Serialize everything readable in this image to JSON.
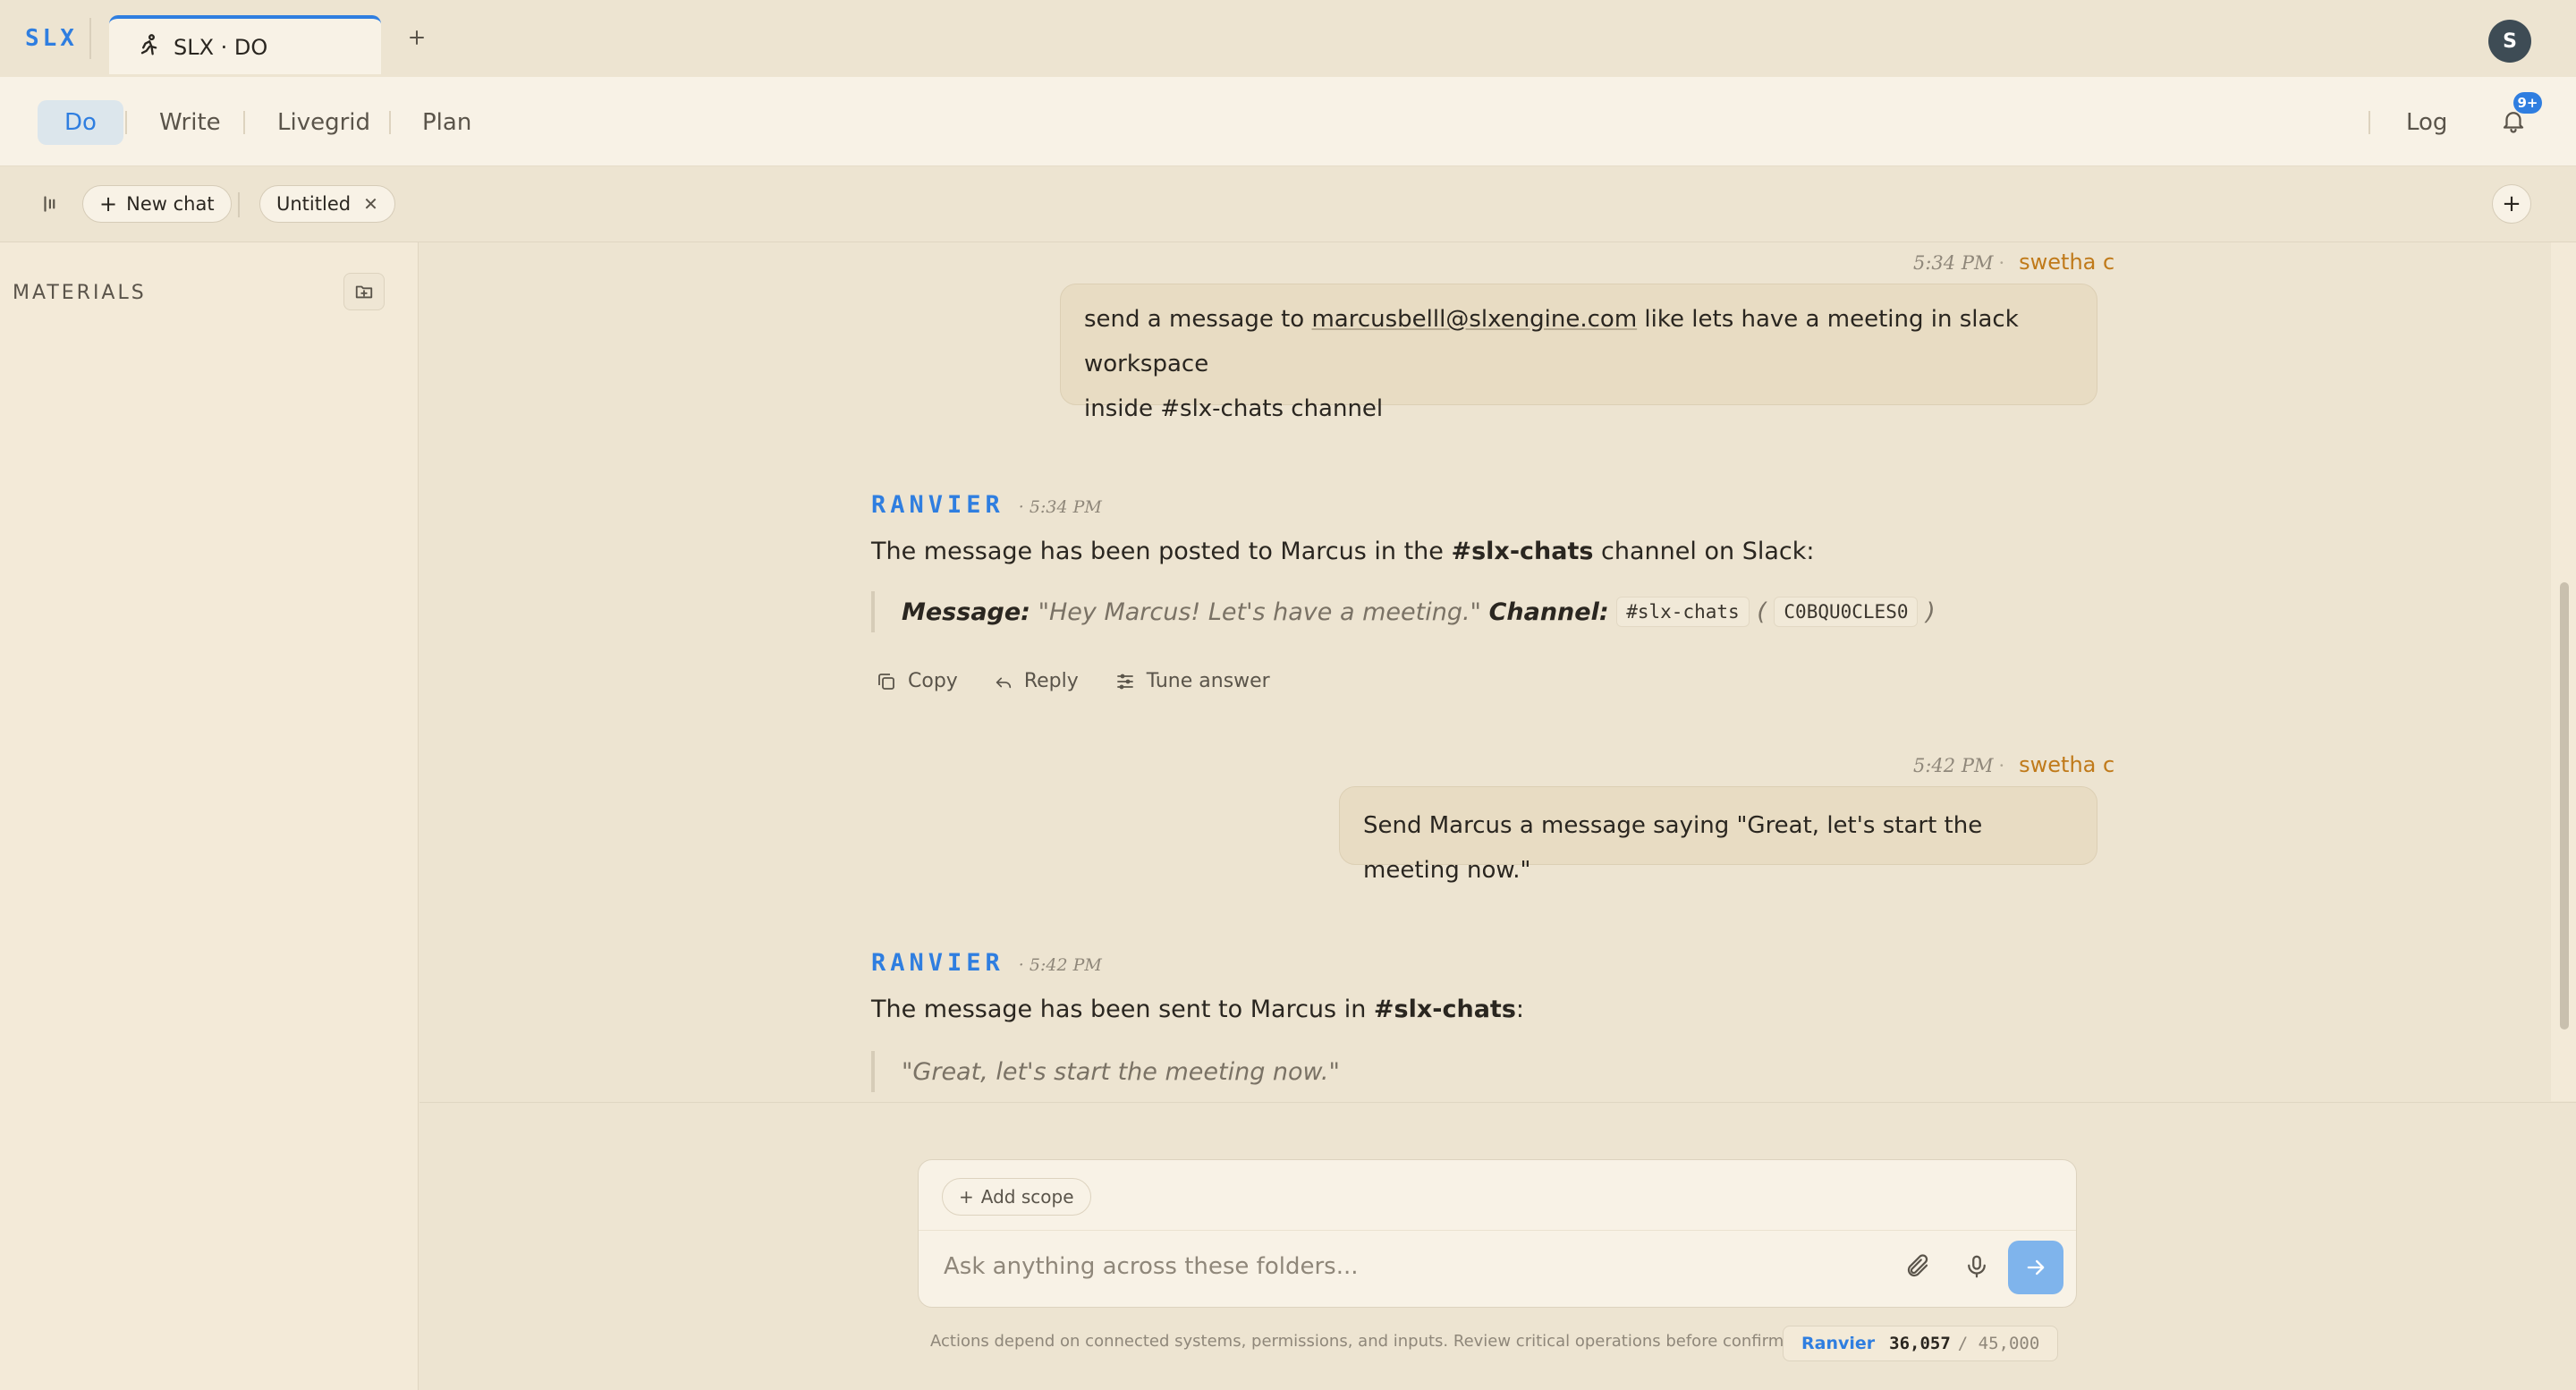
{
  "app": {
    "brand": "SLX",
    "tab_title": "SLX · DO",
    "avatar_initial": "S",
    "accent_color": "#2f7ee0"
  },
  "nav": {
    "items": [
      "Do",
      "Write",
      "Livegrid",
      "Plan"
    ],
    "log": "Log",
    "notification_badge": "9+"
  },
  "toolbar": {
    "new_chat": "New chat",
    "chat_tab": "Untitled"
  },
  "sidebar": {
    "heading": "MATERIALS"
  },
  "messages": {
    "m1": {
      "time": "5:34 PM",
      "author": "swetha c",
      "text_pre": "send a message to ",
      "email": "marcusbelll@slxengine.com",
      "text_mid": " like lets have a meeting in slack workspace",
      "text_line2": "inside #slx-chats channel"
    },
    "m2": {
      "agent": "RANVIER",
      "time": "5:34 PM",
      "text_pre": "The message has been posted to Marcus in the ",
      "channel": "#slx-chats",
      "text_post": " channel on Slack:",
      "quote_label1": "Message:",
      "quote_msg": " \"Hey Marcus! Let's have a meeting.\" ",
      "quote_label2": "Channel:",
      "code1": "#slx-chats",
      "paren_open": "(",
      "code2": "C0BQU0CLES0",
      "paren_close": ")"
    },
    "actions": {
      "copy": "Copy",
      "reply": "Reply",
      "tune": "Tune answer"
    },
    "m3": {
      "time": "5:42 PM",
      "author": "swetha c",
      "text": "Send Marcus a message saying \"Great, let's start the meeting now.\""
    },
    "m4": {
      "agent": "RANVIER",
      "time": "5:42 PM",
      "text_pre": "The message has been sent to Marcus in ",
      "channel": "#slx-chats",
      "text_post": ":",
      "quote": "\"Great, let's start the meeting now.\""
    }
  },
  "composer": {
    "scope": "Add scope",
    "placeholder": "Ask anything across these folders...",
    "disclaimer": "Actions depend on connected systems, permissions, and inputs. Review critical operations before confirming.",
    "quota_name": "Ranvier",
    "quota_used": "36,057",
    "quota_total": "/ 45,000"
  }
}
